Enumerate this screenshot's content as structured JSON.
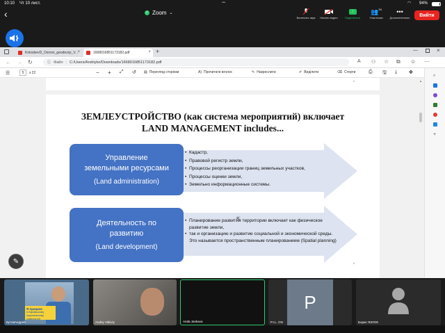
{
  "status": {
    "time": "10:10",
    "date": "Чт 10 лист.",
    "battery": "94%"
  },
  "zoom": {
    "title": "Zoom",
    "exit_label": "Вийти",
    "participants_count": "34",
    "buttons": [
      {
        "label": "Включить звук",
        "icon": "mic-muted-icon"
      },
      {
        "label": "Начать видео",
        "icon": "video-off-icon"
      },
      {
        "label": "Поделиться",
        "icon": "share-icon"
      },
      {
        "label": "Участники",
        "icon": "participants-icon"
      },
      {
        "label": "Дополнительно",
        "icon": "more-icon"
      }
    ]
  },
  "browser": {
    "tabs": [
      {
        "label": "KolosbevD_Osnovi_geodeziyi_V...",
        "active": false
      },
      {
        "label": "1668016851173182.pdf",
        "active": true
      }
    ],
    "address_prefix": "Файл",
    "address": "C:/Users/Andriyko/Downloads/1668016851173182.pdf"
  },
  "pdf_toolbar": {
    "page_current": "5",
    "page_total": "з 22",
    "zoom_minus": "−",
    "zoom_plus": "+",
    "items": [
      {
        "label": "Перегляд сторінки",
        "icon": "page-view-icon"
      },
      {
        "label": "Прочитати вголос",
        "icon": "read-aloud-icon"
      },
      {
        "label": "Накреслити",
        "icon": "draw-icon"
      },
      {
        "label": "Виділити",
        "icon": "highlight-icon"
      },
      {
        "label": "Стерти",
        "icon": "eraser-icon"
      }
    ]
  },
  "prev_page_number": "4",
  "slide": {
    "title_line1": "ЗЕМЛЕУСТРОЙСТВО (как система мероприятий) включает",
    "title_line2": "LAND MANAGEMENT includes...",
    "page_number": "5",
    "box1": {
      "title_line1": "Управление",
      "title_line2": "земельными ресурсами",
      "sub": "(Land administration)",
      "bullets": [
        "Кадастр,",
        "Правовой регистр земли,",
        "Процессы реорганизации границ земельных участков,",
        "Процессы оценки  земли,",
        "Земельно информационные системы."
      ]
    },
    "box2": {
      "title_line1": "Деятельность по",
      "title_line2": "развитию",
      "sub": "(Land development)",
      "bullets": [
        "Планирование развития территории включает   как физическое развитие земли,",
        "так и организацию и развитие социальной и экономической среды. Это называется пространственным планированием (Spatial planning)"
      ]
    }
  },
  "participants": [
    {
      "name": "БутовАндрей",
      "banner_line1": "Я працюю",
      "banner_line2": "в Харківському національному університеті"
    },
    {
      "name": "Andriy Vitkiviy"
    },
    {
      "name": "Anda Jankava"
    },
    {
      "name": "P.I.L.  ON",
      "initial": "P"
    },
    {
      "name": "Борис ЯЗЛОК"
    }
  ],
  "colors": {
    "box_blue": "#4472c4",
    "arrow_blue": "#dde3f0",
    "exit_red": "#e8241f",
    "share_green": "#23c45e",
    "zoom_green": "#2ecc71"
  }
}
